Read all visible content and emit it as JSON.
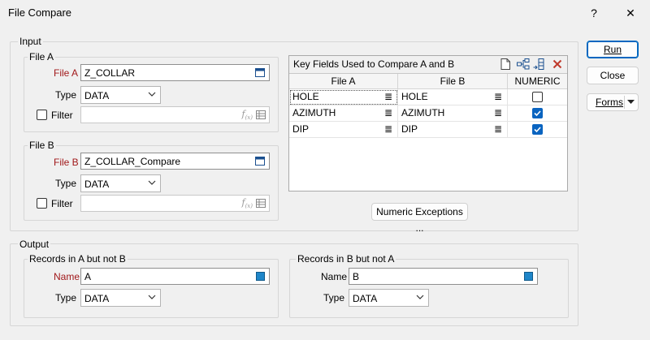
{
  "window": {
    "title": "File Compare",
    "help": "?",
    "close": "✕"
  },
  "input": {
    "legend": "Input",
    "file_a": {
      "legend": "File A",
      "file_label": "File A",
      "file_value": "Z_COLLAR",
      "type_label": "Type",
      "type_value": "DATA",
      "filter_label": "Filter",
      "filter_value": ""
    },
    "file_b": {
      "legend": "File B",
      "file_label": "File B",
      "file_value": "Z_COLLAR_Compare",
      "type_label": "Type",
      "type_value": "DATA",
      "filter_label": "Filter",
      "filter_value": ""
    },
    "key_fields": {
      "title": "Key Fields Used to Compare A and B",
      "columns": [
        "File A",
        "File B",
        "NUMERIC"
      ],
      "rows": [
        {
          "a": "HOLE",
          "b": "HOLE",
          "numeric": false
        },
        {
          "a": "AZIMUTH",
          "b": "AZIMUTH",
          "numeric": true
        },
        {
          "a": "DIP",
          "b": "DIP",
          "numeric": true
        }
      ]
    },
    "numeric_exceptions_label": "Numeric Exceptions ..."
  },
  "output": {
    "legend": "Output",
    "a_not_b": {
      "legend": "Records in A but not B",
      "name_label": "Name",
      "name_value": "A",
      "type_label": "Type",
      "type_value": "DATA"
    },
    "b_not_a": {
      "legend": "Records in B but not A",
      "name_label": "Name",
      "name_value": "B",
      "type_label": "Type",
      "type_value": "DATA"
    }
  },
  "buttons": {
    "run": "Run",
    "close": "Close",
    "forms": "Forms"
  },
  "colors": {
    "accent": "#0067c0",
    "required_label": "#a1181a",
    "swatch": "#1f86c9",
    "delete": "#c0392b"
  }
}
